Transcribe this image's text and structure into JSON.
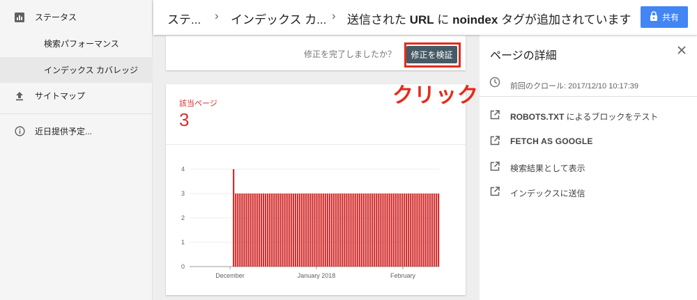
{
  "sidebar": {
    "items": [
      {
        "label": "ステータス",
        "icon": "bar-chart-icon"
      },
      {
        "label": "検索パフォーマンス"
      },
      {
        "label": "インデックス カバレッジ"
      },
      {
        "label": "サイトマップ",
        "icon": "upload-icon"
      },
      {
        "label": "近日提供予定...",
        "icon": "info-icon"
      }
    ]
  },
  "header": {
    "crumbs": [
      "ステ...",
      "インデックス カ...",
      "送信された",
      "URL",
      "に",
      "noindex",
      "タグが追加されています"
    ],
    "share_label": "共有"
  },
  "top_card": {
    "question": "修正を完了しましたか？",
    "verify_label": "修正を検証"
  },
  "annotation": {
    "note": "クリック",
    "color": "#e52b1c"
  },
  "metric": {
    "label": "該当ページ",
    "value": "3"
  },
  "chart_data": {
    "type": "bar",
    "y_ticks": [
      0,
      1,
      2,
      3,
      4
    ],
    "ylim": [
      0,
      4
    ],
    "x_tick_labels": [
      "December",
      "January 2018",
      "February"
    ],
    "values": [
      4,
      3,
      3,
      3,
      3,
      3,
      3,
      3,
      3,
      3,
      3,
      3,
      3,
      3,
      3,
      3,
      3,
      3,
      3,
      3,
      3,
      3,
      3,
      3,
      3,
      3,
      3,
      3,
      3,
      3,
      3,
      3,
      3,
      3,
      3,
      3,
      3,
      3,
      3,
      3,
      3,
      3,
      3,
      3,
      3,
      3,
      3,
      3,
      3,
      3,
      3,
      3,
      3,
      3,
      3,
      3,
      3,
      3,
      3,
      3,
      3,
      3,
      3,
      3,
      3,
      3,
      3,
      3,
      3,
      3,
      3,
      3,
      3,
      3,
      3,
      3,
      3,
      3,
      3,
      3,
      3,
      3,
      3,
      3,
      3,
      3,
      3,
      3,
      3,
      3,
      3,
      3,
      3,
      3,
      3,
      3,
      3
    ],
    "bar_color": "#d32f2f"
  },
  "panel": {
    "title": "ページの詳細",
    "last_crawl": "前回のクロール: 2017/12/10 10:17:39",
    "actions": [
      {
        "label": "ROBOTS.TXT",
        "suffix": " によるブロックをテスト"
      },
      {
        "label": "FETCH AS GOOGLE",
        "suffix": ""
      },
      {
        "label": "検索結果として表示",
        "suffix": ""
      },
      {
        "label": "インデックスに送信",
        "suffix": ""
      }
    ]
  }
}
